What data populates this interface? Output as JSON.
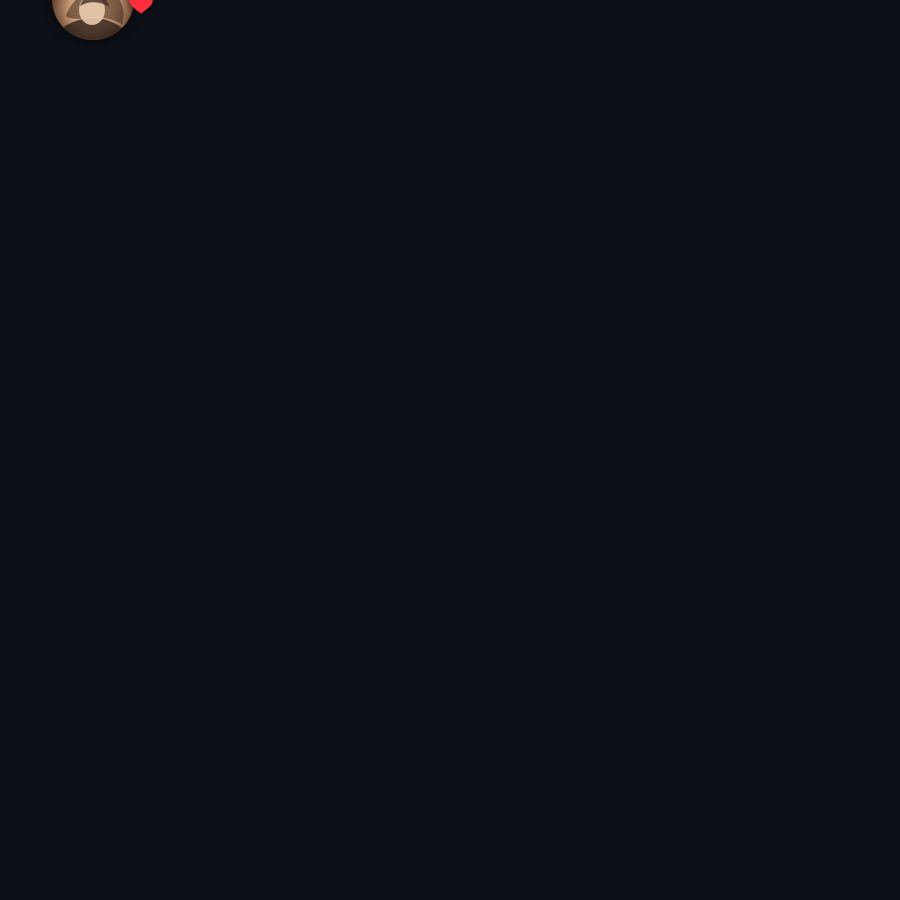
{
  "app": {
    "background_color": "#0d1016"
  },
  "header": {
    "avatar": {
      "icon": "user-avatar",
      "has_badge": true
    },
    "badge": {
      "icon": "heart-icon",
      "color": "#ff2d3b"
    }
  }
}
